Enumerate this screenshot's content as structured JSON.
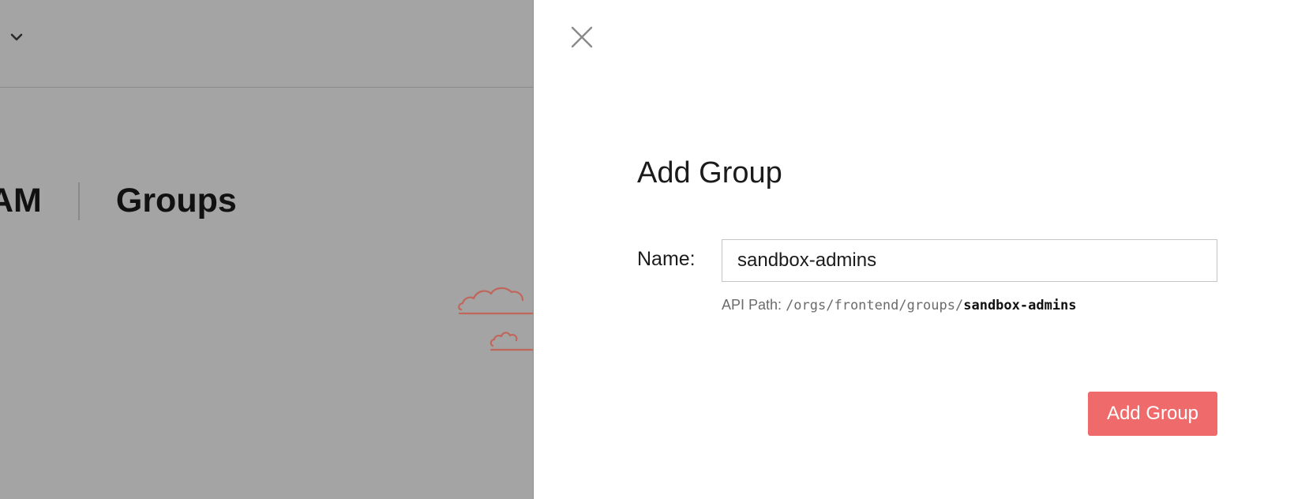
{
  "background": {
    "breadcrumb_prev": "AM",
    "page_title": "Groups"
  },
  "drawer": {
    "title": "Add Group",
    "name_label": "Name:",
    "name_value": "sandbox-admins",
    "api_path_label": "API Path:",
    "api_path_prefix": "/orgs/frontend/groups/",
    "api_path_suffix": "sandbox-admins",
    "submit_label": "Add Group"
  },
  "icons": {
    "close": "close-icon",
    "chevron": "chevron-down-icon",
    "illustration": "clouds-illustration"
  },
  "colors": {
    "overlay": "#a4a4a4",
    "accent": "#ef6b6b",
    "illustration": "#c0665b"
  }
}
